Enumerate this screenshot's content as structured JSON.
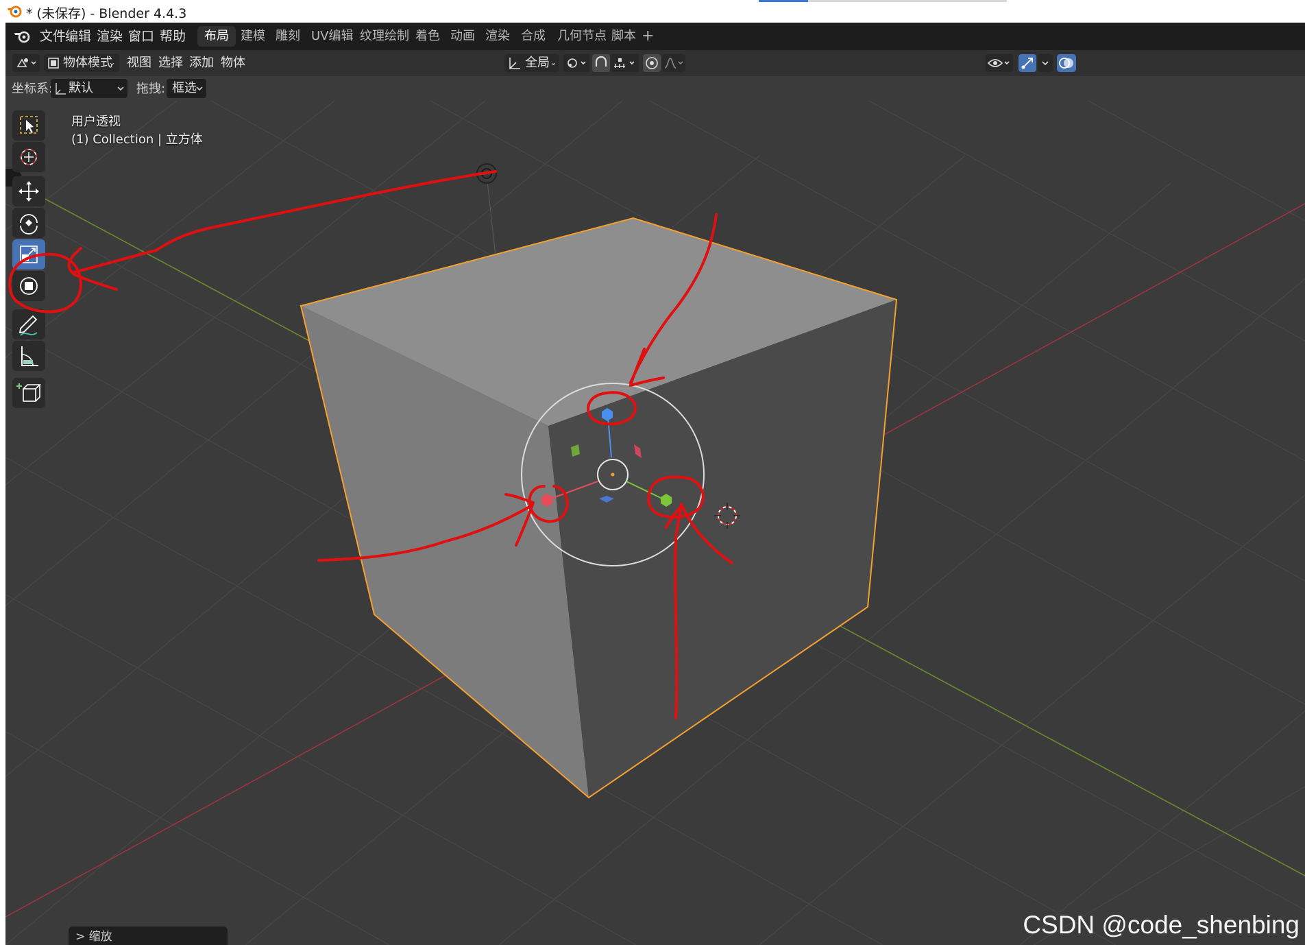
{
  "window": {
    "title": "* (未保存) - Blender 4.4.3"
  },
  "menubar": {
    "items": [
      "文件",
      "编辑",
      "渲染",
      "窗口",
      "帮助"
    ],
    "workspaces": [
      "布局",
      "建模",
      "雕刻",
      "UV编辑",
      "纹理绘制",
      "着色",
      "动画",
      "渲染",
      "合成",
      "几何节点",
      "脚本"
    ],
    "active_workspace": "布局",
    "add_tab": "+"
  },
  "header": {
    "mode": "物体模式",
    "menus": [
      "视图",
      "选择",
      "添加",
      "物体"
    ],
    "transform_orientation": "全局"
  },
  "tool_settings": {
    "coord_label": "坐标系:",
    "coord_value": "默认",
    "drag_label": "拖拽:",
    "drag_value": "框选"
  },
  "viewport": {
    "view_name": "用户透视",
    "collection": "(1) Collection | 立方体"
  },
  "toolbar": {
    "tools": [
      "select-box-tool",
      "cursor-tool",
      "move-tool",
      "rotate-tool",
      "scale-tool",
      "transform-tool",
      "annotate-tool",
      "measure-tool",
      "add-cube-tool"
    ],
    "active_tool": "scale-tool"
  },
  "last_operator": {
    "label": "> 缩放"
  },
  "watermark": "CSDN @code_shenbing",
  "colors": {
    "accent": "#4772b3",
    "selection_outline": "#f5a030",
    "annotation": "#e01010",
    "axis_x": "#e84b5a",
    "axis_y": "#7cc43a",
    "axis_z": "#4a8ef0"
  }
}
